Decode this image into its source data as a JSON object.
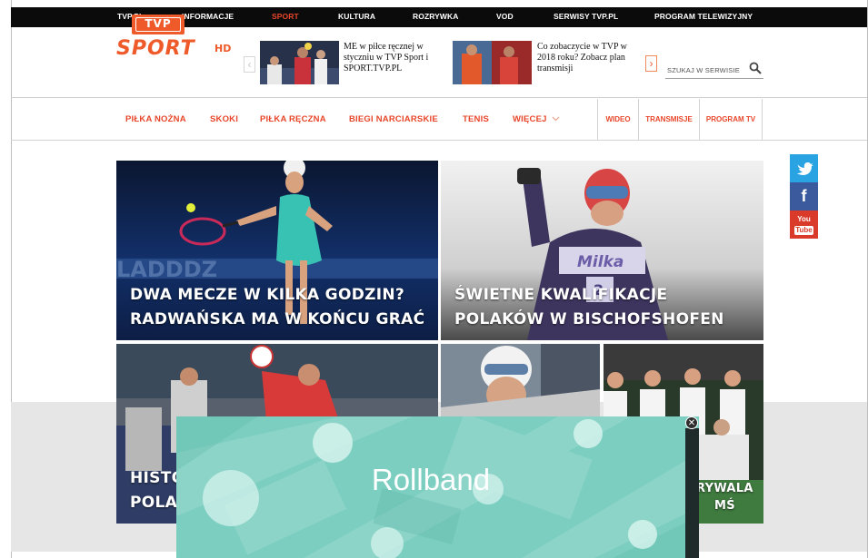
{
  "topbar": {
    "items": [
      {
        "label": "TVP.PL"
      },
      {
        "label": "INFORMACJE"
      },
      {
        "label": "SPORT",
        "active": true
      },
      {
        "label": "KULTURA"
      },
      {
        "label": "ROZRYWKA"
      },
      {
        "label": "VOD"
      },
      {
        "label": "SERWISY TVP.PL"
      },
      {
        "label": "PROGRAM TELEWIZYJNY"
      }
    ],
    "active_color": "#e8462a"
  },
  "logo": {
    "tvp": "TVP",
    "sport": "SPORT",
    "hd": "HD",
    "color": "#ef5a2a"
  },
  "promos": [
    {
      "text": "ME w piłce ręcznej w styczniu w TVP Sport i SPORT.TVP.PL"
    },
    {
      "text": "Co zobaczycie w TVP w 2018 roku? Zobacz plan transmisji"
    }
  ],
  "nav_arrows": {
    "prev": "‹",
    "next": "›"
  },
  "search": {
    "label": "SZUKAJ W SERWISIE"
  },
  "categories": [
    {
      "label": "PIŁKA NOŻNA"
    },
    {
      "label": "SKOKI"
    },
    {
      "label": "PIŁKA RĘCZNA"
    },
    {
      "label": "BIEGI NARCIARSKIE"
    },
    {
      "label": "TENIS"
    },
    {
      "label": "WIĘCEJ"
    }
  ],
  "category_boxes": [
    {
      "label": "WIDEO"
    },
    {
      "label": "TRANSMISJE"
    },
    {
      "label": "PROGRAM TV"
    }
  ],
  "tiles": {
    "tile1": {
      "line1": "DWA MECZE W KILKA GODZIN?",
      "line2": "RADWAŃSKA MA W KOŃCU GRAĆ"
    },
    "tile2": {
      "line1": "ŚWIETNE KWALIFIKACJE",
      "line2": "POLAKÓW W BISCHOFSHOFEN"
    },
    "tile3": {
      "line1": "HISTO",
      "line2": "POLA"
    },
    "tile5": {
      "line1": "RYWALA",
      "line2": "MŚ"
    }
  },
  "social": {
    "twitter": "t",
    "facebook": "f",
    "youtube_top": "You",
    "youtube_bottom": "Tube"
  },
  "rollband": {
    "label": "Rollband",
    "close": "✕"
  }
}
